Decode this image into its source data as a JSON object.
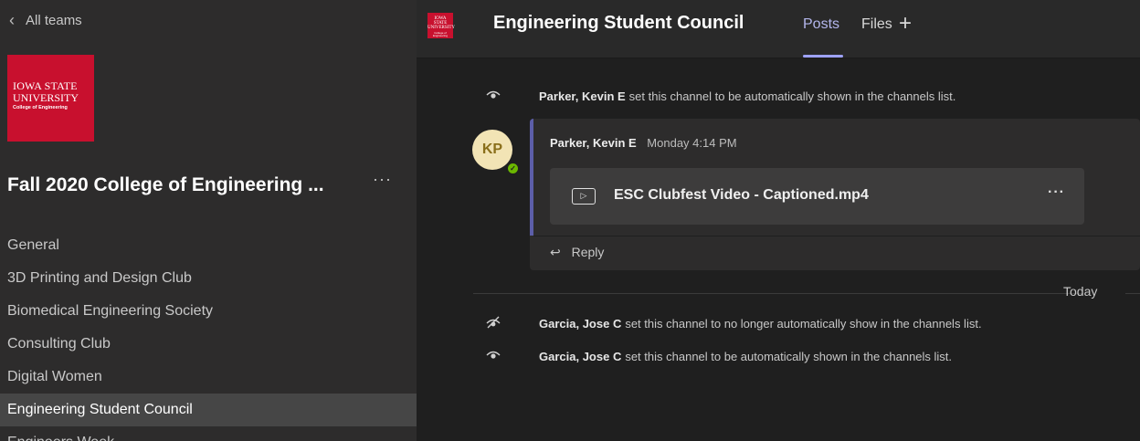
{
  "sidebar": {
    "back_label": "All teams",
    "team_logo": {
      "line1": "Iowa State",
      "line2": "University",
      "line3": "College of Engineering"
    },
    "team_name": "Fall 2020 College of Engineering ...",
    "more_label": "···",
    "channels": [
      {
        "label": "General"
      },
      {
        "label": "3D Printing and Design Club"
      },
      {
        "label": "Biomedical Engineering Society"
      },
      {
        "label": "Consulting Club"
      },
      {
        "label": "Digital Women"
      },
      {
        "label": "Engineering Student Council"
      },
      {
        "label": "Engineers Week"
      }
    ],
    "active_channel": "Engineering Student Council"
  },
  "header": {
    "logo": {
      "line1": "Iowa State University",
      "line2": "College of Engineering"
    },
    "title": "Engineering Student Council",
    "tabs": [
      {
        "label": "Posts"
      },
      {
        "label": "Files"
      }
    ],
    "active_tab": "Posts",
    "add_label": "+"
  },
  "feed": {
    "system1": {
      "name": "Parker, Kevin E",
      "text": "set this channel to be automatically shown in the channels list."
    },
    "post": {
      "avatar_initials": "KP",
      "author": "Parker, Kevin E",
      "time": "Monday 4:14 PM",
      "attachment_name": "ESC Clubfest Video - Captioned.mp4",
      "attachment_more": "···",
      "reply_label": "Reply"
    },
    "divider_label": "Today",
    "system2": {
      "name": "Garcia, Jose C",
      "text": "set this channel to no longer automatically show in the channels list."
    },
    "system3": {
      "name": "Garcia, Jose C",
      "text": "set this channel to be automatically shown in the channels list."
    }
  },
  "colors": {
    "accent": "#9ea2ff",
    "logo_red": "#c8102e",
    "presence": "#6bb700"
  },
  "icons": {
    "back": "chevron-left-icon",
    "show": "eye-icon",
    "hide": "eye-off-icon",
    "video": "video-file-icon",
    "reply": "reply-icon",
    "presence": "available-check-icon"
  }
}
